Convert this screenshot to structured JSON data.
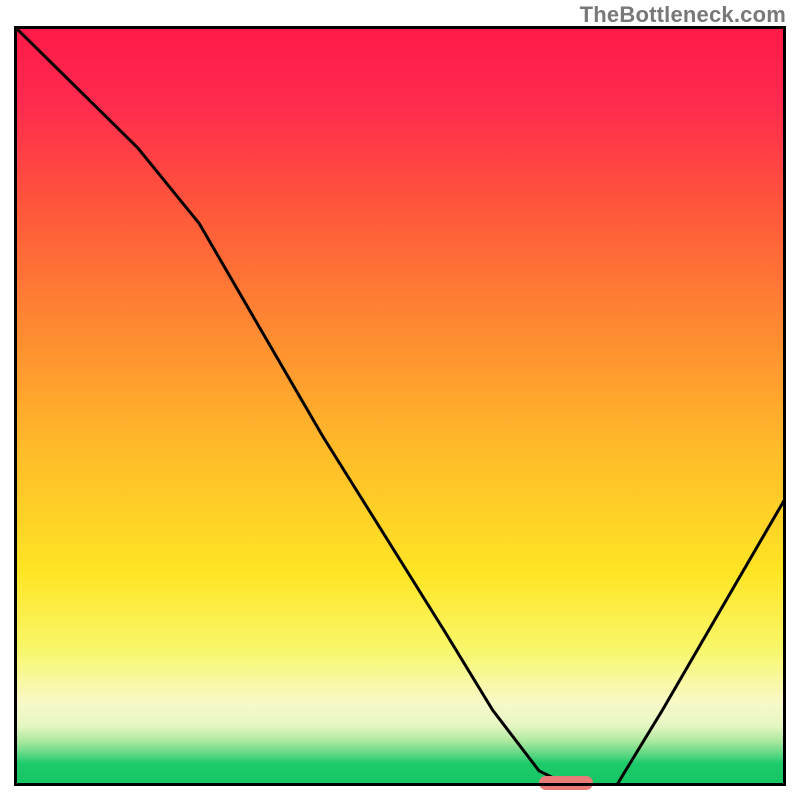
{
  "watermark": "TheBottleneck.com",
  "colors": {
    "gradient_top": "#ff1a47",
    "gradient_mid": "#ffc02a",
    "gradient_bottom": "#14c462",
    "curve": "#000000",
    "marker": "#e97c78",
    "border": "#000000"
  },
  "chart_data": {
    "type": "line",
    "title": "",
    "xlabel": "",
    "ylabel": "",
    "xlim": [
      0,
      100
    ],
    "ylim": [
      0,
      100
    ],
    "grid": false,
    "legend": false,
    "x": [
      0,
      8,
      16,
      24,
      32,
      40,
      48,
      56,
      62,
      68,
      72,
      75,
      78,
      84,
      92,
      100
    ],
    "values": [
      100,
      92,
      84,
      74,
      60,
      46,
      33,
      20,
      10,
      2,
      0,
      0,
      0,
      10,
      24,
      38
    ],
    "marker": {
      "x_start": 68,
      "x_end": 75,
      "y": 0
    },
    "notes": "Percent-scale axes with no tick labels; values estimated from pixel positions.",
    "approximate": true
  }
}
